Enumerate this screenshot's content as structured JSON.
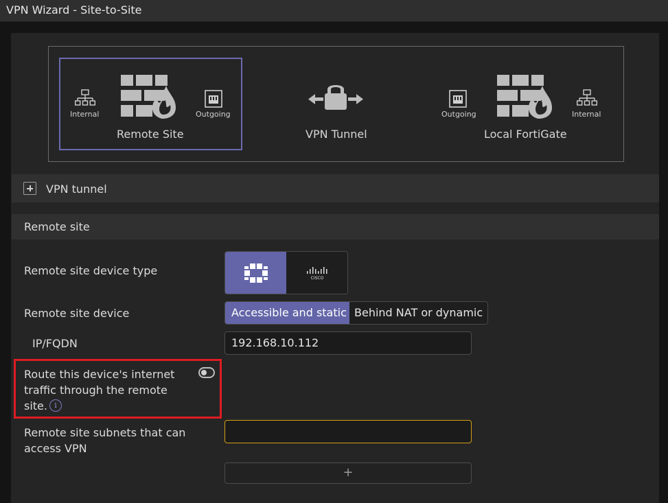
{
  "window": {
    "title": "VPN Wizard - Site-to-Site"
  },
  "topology": {
    "remote": {
      "label": "Remote Site",
      "internal_label": "Internal",
      "outgoing_label": "Outgoing"
    },
    "tunnel": {
      "label": "VPN Tunnel"
    },
    "local": {
      "label": "Local FortiGate",
      "outgoing_label": "Outgoing",
      "internal_label": "Internal"
    }
  },
  "sections": {
    "vpn_tunnel": {
      "label": "VPN tunnel",
      "collapsed": true
    },
    "remote_site": {
      "label": "Remote site"
    }
  },
  "form": {
    "device_type": {
      "label": "Remote site device type",
      "options": [
        "fortigate-icon",
        "cisco-icon"
      ],
      "selected": "fortigate-icon",
      "cisco_text": "CISCO"
    },
    "device": {
      "label": "Remote site device",
      "options": [
        "Accessible and static",
        "Behind NAT or dynamic"
      ],
      "selected": "Accessible and static"
    },
    "ip_fqdn": {
      "label": "IP/FQDN",
      "value": "192.168.10.112"
    },
    "route_internet": {
      "label_line1": "Route this device's internet",
      "label_line2": "traffic through the remote",
      "label_line3": "site.",
      "enabled": false,
      "info_glyph": "i"
    },
    "subnets": {
      "label_line1": "Remote site subnets that can",
      "label_line2": "access VPN",
      "value": "",
      "add_glyph": "+"
    }
  },
  "colors": {
    "accent": "#6365a8",
    "highlight": "#dd1c24",
    "focus_border": "#d4a017"
  }
}
